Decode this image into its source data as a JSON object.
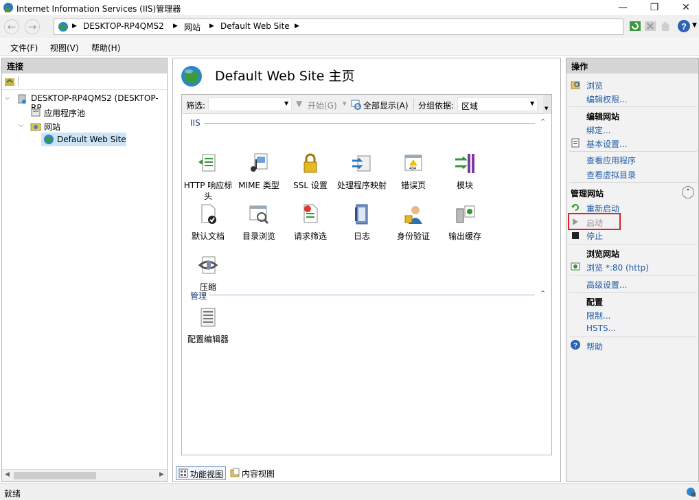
{
  "window": {
    "title": "Internet Information Services (IIS)管理器",
    "min": "—",
    "max": "❐",
    "close": "✕"
  },
  "address": {
    "crumbs": [
      "DESKTOP-RP4QMS2",
      "网站",
      "Default Web Site"
    ]
  },
  "menu": [
    "文件(F)",
    "视图(V)",
    "帮助(H)"
  ],
  "connections": {
    "title": "连接",
    "tree": {
      "server": "DESKTOP-RP4QMS2 (DESKTOP-RP",
      "app_pools": "应用程序池",
      "sites": "网站",
      "default_site": "Default Web Site"
    }
  },
  "main": {
    "title": "Default Web Site 主页",
    "filter_label": "筛选:",
    "start_label": "开始(G)",
    "show_all_label": "全部显示(A)",
    "group_label": "分组依据:",
    "group_value": "区域",
    "sections": {
      "iis": "IIS",
      "manage": "管理"
    },
    "iis_features": [
      {
        "label": "HTTP 响应标头",
        "icon": "http-response-headers-icon"
      },
      {
        "label": "MIME 类型",
        "icon": "mime-types-icon"
      },
      {
        "label": "SSL 设置",
        "icon": "ssl-lock-icon"
      },
      {
        "label": "处理程序映射",
        "icon": "handler-mappings-icon"
      },
      {
        "label": "错误页",
        "icon": "error-pages-icon"
      },
      {
        "label": "模块",
        "icon": "modules-icon"
      },
      {
        "label": "默认文档",
        "icon": "default-document-icon"
      },
      {
        "label": "目录浏览",
        "icon": "directory-browsing-icon"
      },
      {
        "label": "请求筛选",
        "icon": "request-filtering-icon"
      },
      {
        "label": "日志",
        "icon": "logging-icon"
      },
      {
        "label": "身份验证",
        "icon": "authentication-icon"
      },
      {
        "label": "输出缓存",
        "icon": "output-caching-icon"
      },
      {
        "label": "压缩",
        "icon": "compression-icon"
      }
    ],
    "manage_features": [
      {
        "label": "配置编辑器",
        "icon": "configuration-editor-icon"
      }
    ],
    "tabs": {
      "feature_view": "功能视图",
      "content_view": "内容视图"
    }
  },
  "actions": {
    "title": "操作",
    "browse": "浏览",
    "edit_permissions": "编辑权限...",
    "edit_site_header": "编辑网站",
    "bindings": "绑定...",
    "basic_settings": "基本设置...",
    "view_apps": "查看应用程序",
    "view_vdirs": "查看虚拟目录",
    "manage_site_header": "管理网站",
    "restart": "重新启动",
    "start": "启动",
    "stop": "停止",
    "browse_site_header": "浏览网站",
    "browse_port": "浏览 *:80 (http)",
    "advanced_settings": "高级设置...",
    "config_header": "配置",
    "limits": "限制...",
    "hsts": "HSTS...",
    "help": "帮助"
  },
  "status": {
    "text": "就绪"
  },
  "colors": {
    "link": "#1f5ca8",
    "highlight_box": "#d9222a",
    "selection": "#cce4f7"
  }
}
